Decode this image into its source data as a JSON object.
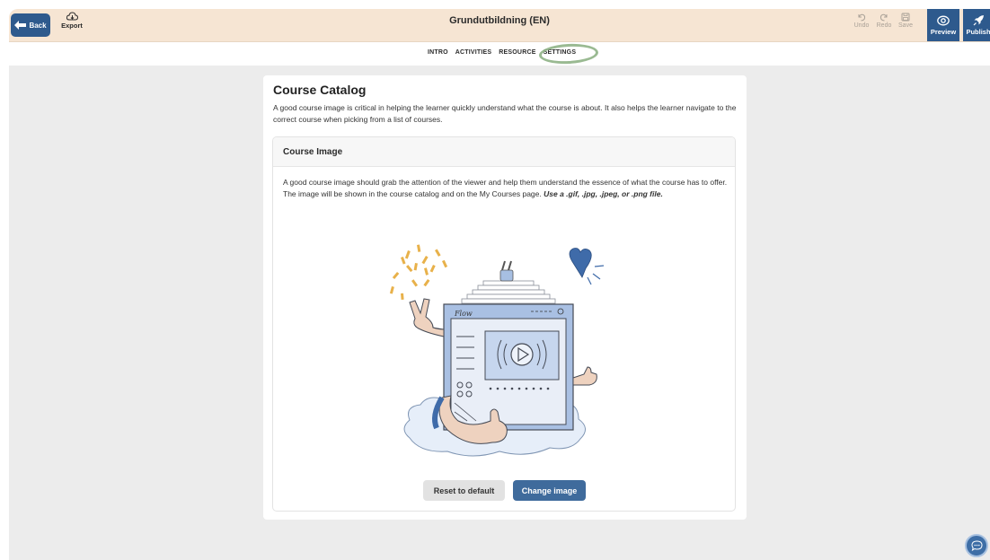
{
  "topbar": {
    "back_label": "Back",
    "export_label": "Export",
    "title": "Grundutbildning (EN)",
    "undo_label": "Undo",
    "redo_label": "Redo",
    "save_label": "Save",
    "preview_label": "Preview",
    "publish_label": "Publish"
  },
  "tabs": [
    {
      "label": "INTRO"
    },
    {
      "label": "ACTIVITIES"
    },
    {
      "label": "RESOURCE"
    },
    {
      "label": "SETTINGS"
    }
  ],
  "card": {
    "title": "Course Catalog",
    "description": "A good course image is critical in helping the learner quickly understand what the course is about. It also helps the learner navigate to the correct course when picking from a list of courses.",
    "panel": {
      "title": "Course Image",
      "text": "A good course image should grab the attention of the viewer and help them understand the essence of what the course has to offer. The image will be shown in the course catalog and on the My Courses page.",
      "hint": "Use a .gif, .jpg, .jpeg, or .png file.",
      "reset_label": "Reset to default",
      "change_label": "Change image"
    }
  },
  "colors": {
    "topbar_bg": "#f6e5d3",
    "primary": "#2e5a8d",
    "highlight_circle": "#8fb286",
    "page_bg": "#ececec"
  },
  "icons": {
    "back": "arrow-left-icon",
    "export": "cloud-download-icon",
    "undo": "undo-icon",
    "redo": "redo-icon",
    "save": "floppy-disk-icon",
    "preview": "eye-icon",
    "publish": "rocket-icon",
    "chat": "chat-bubble-icon"
  }
}
